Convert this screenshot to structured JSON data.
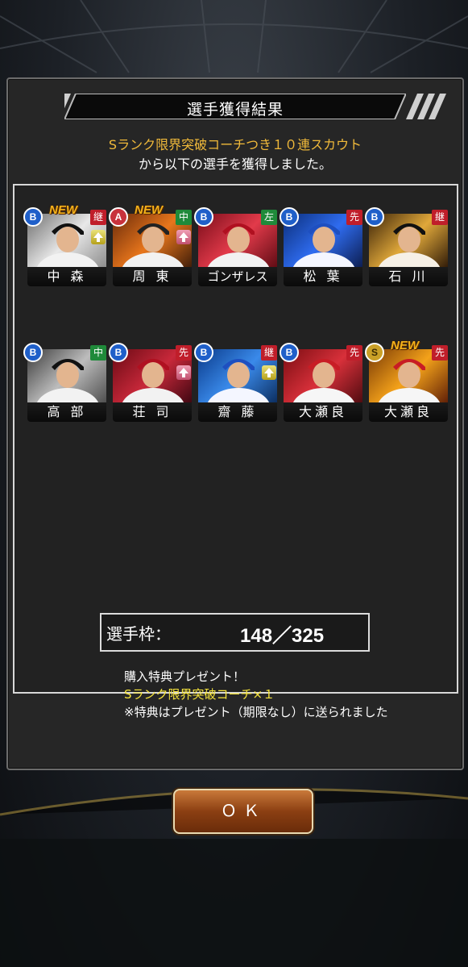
{
  "dialog": {
    "title": "選手獲得結果",
    "message_line1": "Sランク限界突破コーチつき１０連スカウト",
    "message_line2": "から以下の選手を獲得しました。"
  },
  "players": [
    {
      "rank": "B",
      "position": "継",
      "name": "中 森",
      "new": "NEW",
      "up": "yellow"
    },
    {
      "rank": "A",
      "position": "中",
      "name": "周 東",
      "new": "NEW",
      "up": "pink"
    },
    {
      "rank": "B",
      "position": "左",
      "name": "ゴンザレス",
      "new": "",
      "up": ""
    },
    {
      "rank": "B",
      "position": "先",
      "name": "松 葉",
      "new": "",
      "up": ""
    },
    {
      "rank": "B",
      "position": "継",
      "name": "石 川",
      "new": "",
      "up": ""
    },
    {
      "rank": "B",
      "position": "中",
      "name": "高 部",
      "new": "",
      "up": ""
    },
    {
      "rank": "B",
      "position": "先",
      "name": "荘 司",
      "new": "",
      "up": "pink"
    },
    {
      "rank": "B",
      "position": "継",
      "name": "齋 藤",
      "new": "",
      "up": "yellow"
    },
    {
      "rank": "B",
      "position": "先",
      "name": "大瀬良",
      "new": "",
      "up": ""
    },
    {
      "rank": "S",
      "position": "先",
      "name": "大瀬良",
      "new": "NEW",
      "up": ""
    }
  ],
  "bonus": {
    "line1": "購入特典プレゼント！",
    "line2": "Sランク限界突破コーチ×１",
    "line3": "※特典はプレゼント（期限なし）に送られました"
  },
  "roster": {
    "label": "選手枠：",
    "value": "148／325"
  },
  "ok_button": "ＯＫ",
  "colors": {
    "accent_orange": "#f0b93a",
    "bonus_yellow": "#f6e43b",
    "rank_b": "#1f5fc9",
    "rank_a": "#c8323c",
    "rank_s": "#caa027"
  }
}
